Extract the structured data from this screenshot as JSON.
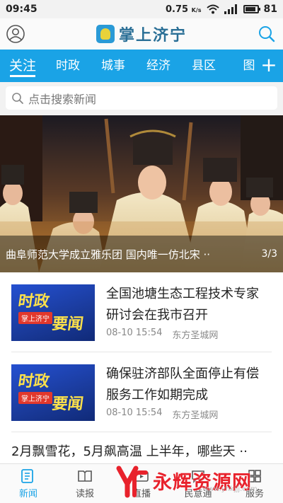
{
  "status_bar": {
    "time": "09:45",
    "net_speed": "0.75",
    "net_unit": "K/s",
    "battery": "81"
  },
  "header": {
    "app_name": "掌上济宁",
    "accent_color": "#1aa3e6"
  },
  "tabs": [
    {
      "label": "关注",
      "active": true
    },
    {
      "label": "时政",
      "active": false
    },
    {
      "label": "城事",
      "active": false
    },
    {
      "label": "经济",
      "active": false
    },
    {
      "label": "县区",
      "active": false
    },
    {
      "label": "图",
      "active": false
    }
  ],
  "tab_add_label": "+",
  "search": {
    "placeholder": "点击搜索新闻"
  },
  "banner": {
    "caption": "曲阜师范大学成立雅乐团 国内唯一仿北宋 ··",
    "counter": "3/3"
  },
  "news": [
    {
      "title": "全国池塘生态工程技术专家研讨会在我市召开",
      "date": "08-10 15:54",
      "source": "东方圣城网",
      "thumb": {
        "word1": "时政",
        "badge": "掌上济宁",
        "word2": "要闻"
      }
    },
    {
      "title": "确保驻济部队全面停止有偿服务工作如期完成",
      "date": "08-10 15:54",
      "source": "东方圣城网",
      "thumb": {
        "word1": "时政",
        "badge": "掌上济宁",
        "word2": "要闻"
      }
    },
    {
      "title": "2月飘雪花，5月飙高温 上半年，哪些天 ··"
    }
  ],
  "bottom_nav": [
    {
      "label": "新闻",
      "icon": "news-icon",
      "active": true
    },
    {
      "label": "读报",
      "icon": "newspaper-icon",
      "active": false
    },
    {
      "label": "直播",
      "icon": "live-icon",
      "active": false
    },
    {
      "label": "民意通",
      "icon": "opinion-icon",
      "active": false
    },
    {
      "label": "服务",
      "icon": "service-icon",
      "active": false
    }
  ],
  "watermark": {
    "text": "永辉资源网",
    "url": "www.yhkjjj.com"
  }
}
